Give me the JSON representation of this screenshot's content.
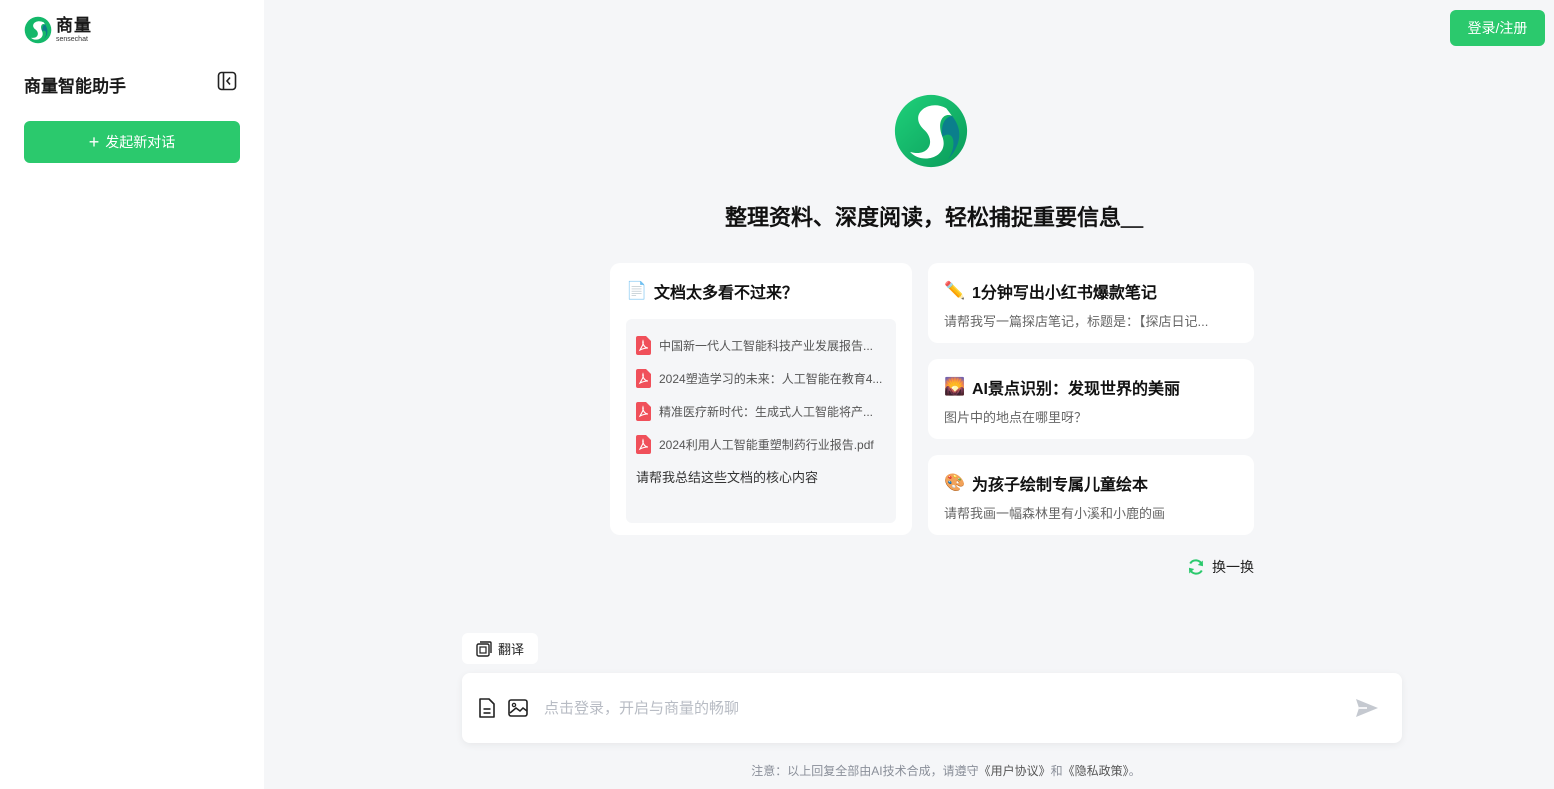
{
  "brand": {
    "name_cn": "商量",
    "name_en": "sensechat",
    "accent": "#2bc96d"
  },
  "sidebar": {
    "title": "商量智能助手",
    "new_chat_label": "发起新对话"
  },
  "header": {
    "login_label": "登录/注册"
  },
  "hero": {
    "title": "整理资料、深度阅读，轻松捕捉重要信息＿"
  },
  "cards": {
    "docs": {
      "icon": "document-emoji",
      "title": "文档太多看不过来？",
      "files": [
        "中国新一代人工智能科技产业发展报告...",
        "2024塑造学习的未来：人工智能在教育4...",
        "精准医疗新时代：生成式人工智能将产...",
        "2024利用人工智能重塑制药行业报告.pdf"
      ],
      "prompt": "请帮我总结这些文档的核心内容"
    },
    "note": {
      "icon": "pencil-emoji",
      "title": "1分钟写出小红书爆款笔记",
      "desc": "请帮我写一篇探店笔记，标题是：【探店日记..."
    },
    "scenery": {
      "icon": "sunset-emoji",
      "title": "AI景点识别：发现世界的美丽",
      "desc": "图片中的地点在哪里呀？"
    },
    "drawing": {
      "icon": "palette-emoji",
      "title": "为孩子绘制专属儿童绘本",
      "desc": "请帮我画一幅森林里有小溪和小鹿的画"
    }
  },
  "refresh_label": "换一换",
  "tool_chip": {
    "label": "翻译"
  },
  "input": {
    "placeholder": "点击登录，开启与商量的畅聊"
  },
  "footer": {
    "prefix": "注意：以上回复全部由AI技术合成，请遵守",
    "link1": "《用户协议》",
    "middle": "和",
    "link2": "《隐私政策》",
    "suffix": "。"
  }
}
